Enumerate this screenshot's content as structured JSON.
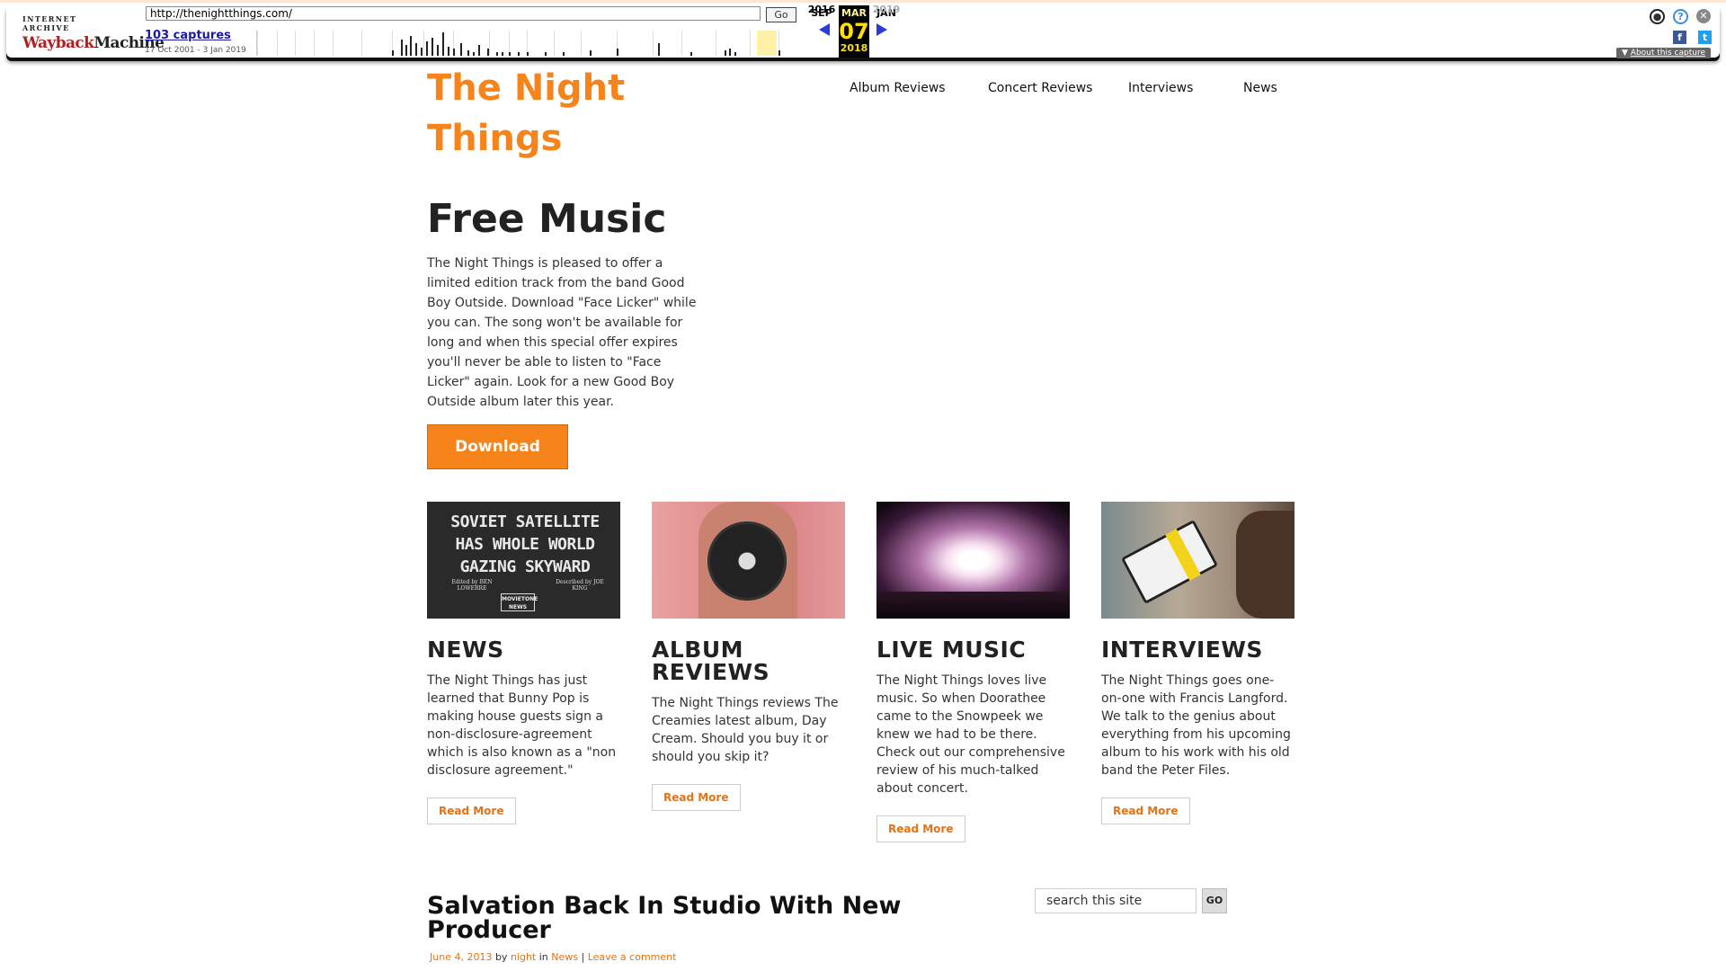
{
  "wayback": {
    "logo_top": "INTERNET ARCHIVE",
    "logo_main_a": "Wayback",
    "logo_main_b": "Machine",
    "url": "http://thenightthings.com/",
    "go_label": "Go",
    "captures_label": "103 captures",
    "date_range": "17 Oct 2001 - 3 Jan 2019",
    "calendar": {
      "prev_month": "SEP",
      "cur_month": "MAR",
      "next_month": "JAN",
      "cur_day": "07",
      "prev_year": "2016",
      "cur_year": "2018",
      "next_year": "2019"
    },
    "about_label": "About this capture",
    "icons": [
      "user-icon",
      "help-icon",
      "close-icon",
      "facebook-icon",
      "twitter-icon"
    ]
  },
  "site": {
    "logo": "The Night Things",
    "accent": "#f6841b",
    "nav": [
      "Album Reviews",
      "Concert Reviews",
      "Interviews",
      "News"
    ],
    "hero": {
      "title": "Free Music",
      "body": "The Night Things is pleased to offer a limited edition track from the band Good Boy Outside. Download \"Face Licker\" while you can. The song won't be available for long and when this special offer expires you'll never be able to listen to \"Face Licker\" again. Look for a new Good Boy Outside album later this year.",
      "button": "Download"
    },
    "cards": [
      {
        "title": "NEWS",
        "image_text": "SOVIET SATELLITE HAS WHOLE WORLD GAZING SKYWARD",
        "image_edited": "Edited by BEN LOWERRE",
        "image_described": "Described by JOE KING",
        "image_badge": "MOVIETONE NEWS",
        "text": "The Night Things has just learned that Bunny Pop is making house guests sign a non-disclosure-agreement which is also known as a \"non disclosure agreement.\"",
        "button": "Read More"
      },
      {
        "title": "ALBUM REVIEWS",
        "text": "The Night Things reviews The Creamies latest album, Day Cream. Should you buy it or should you skip it?",
        "button": "Read More"
      },
      {
        "title": "LIVE MUSIC",
        "text": "The Night Things loves live music. So when Doorathee came to the Snowpeek we knew we had to be there. Check out our comprehensive review of his much-talked about concert.",
        "button": "Read More"
      },
      {
        "title": "INTERVIEWS",
        "text": "The Night Things goes one-on-one with Francis Langford. We talk to the genius about everything from his upcoming album to his work with his old band the Peter Files.",
        "button": "Read More"
      }
    ],
    "post": {
      "title": "Salvation Back In Studio With New Producer",
      "date": "June 4, 2013",
      "by": "by",
      "author": "night",
      "in": "in",
      "category": "News",
      "sep": "|",
      "comments": "Leave a comment"
    },
    "search": {
      "placeholder": "search this site",
      "go": "GO"
    }
  }
}
